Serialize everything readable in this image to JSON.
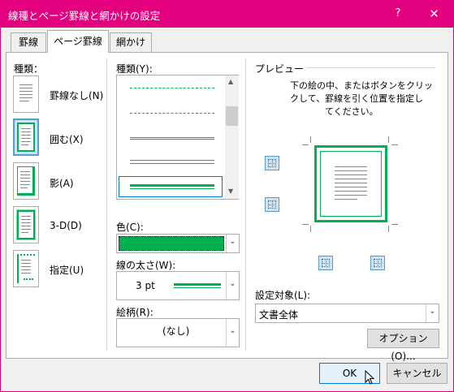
{
  "window": {
    "title": "線種とページ罫線と網かけの設定",
    "help_glyph": "?",
    "close_glyph": "✕"
  },
  "tabs": [
    {
      "label": "罫線",
      "active": false
    },
    {
      "label": "ページ罫線",
      "active": true
    },
    {
      "label": "網かけ",
      "active": false
    }
  ],
  "settings": {
    "label": "種類：",
    "items": [
      {
        "label": "罫線なし(N)",
        "icon": "page-none-icon",
        "selected": false
      },
      {
        "label": "囲む(X)",
        "icon": "page-box-icon",
        "selected": true
      },
      {
        "label": "影(A)",
        "icon": "page-shadow-icon",
        "selected": false
      },
      {
        "label": "3-D(D)",
        "icon": "page-3d-icon",
        "selected": false
      },
      {
        "label": "指定(U)",
        "icon": "page-custom-icon",
        "selected": false
      }
    ]
  },
  "style": {
    "label": "種類(Y):",
    "scroll_up": "▲",
    "scroll_down": "▼"
  },
  "color": {
    "label": "色(C):",
    "value_color": "#00b050",
    "arrow": "⌄"
  },
  "width": {
    "label": "線の太さ(W):",
    "value": "3 pt",
    "arrow": "⌄"
  },
  "art": {
    "label": "絵柄(R):",
    "value": "(なし)",
    "arrow": "⌄"
  },
  "preview": {
    "label": "プレビュー",
    "instruction_line1": "下の絵の中、またはボタンをクリッ",
    "instruction_line2": "クして、罫線を引く位置を指定し",
    "instruction_line3": "てください。"
  },
  "apply_to": {
    "label": "設定対象(L):",
    "value": "文書全体",
    "arrow": "⌄"
  },
  "buttons": {
    "options": "オプション(O)...",
    "ok": "OK",
    "cancel": "キャンセル"
  },
  "colors": {
    "title_bar": "#e3007e",
    "border_green": "#00b050",
    "select_blue": "#0078d7"
  }
}
